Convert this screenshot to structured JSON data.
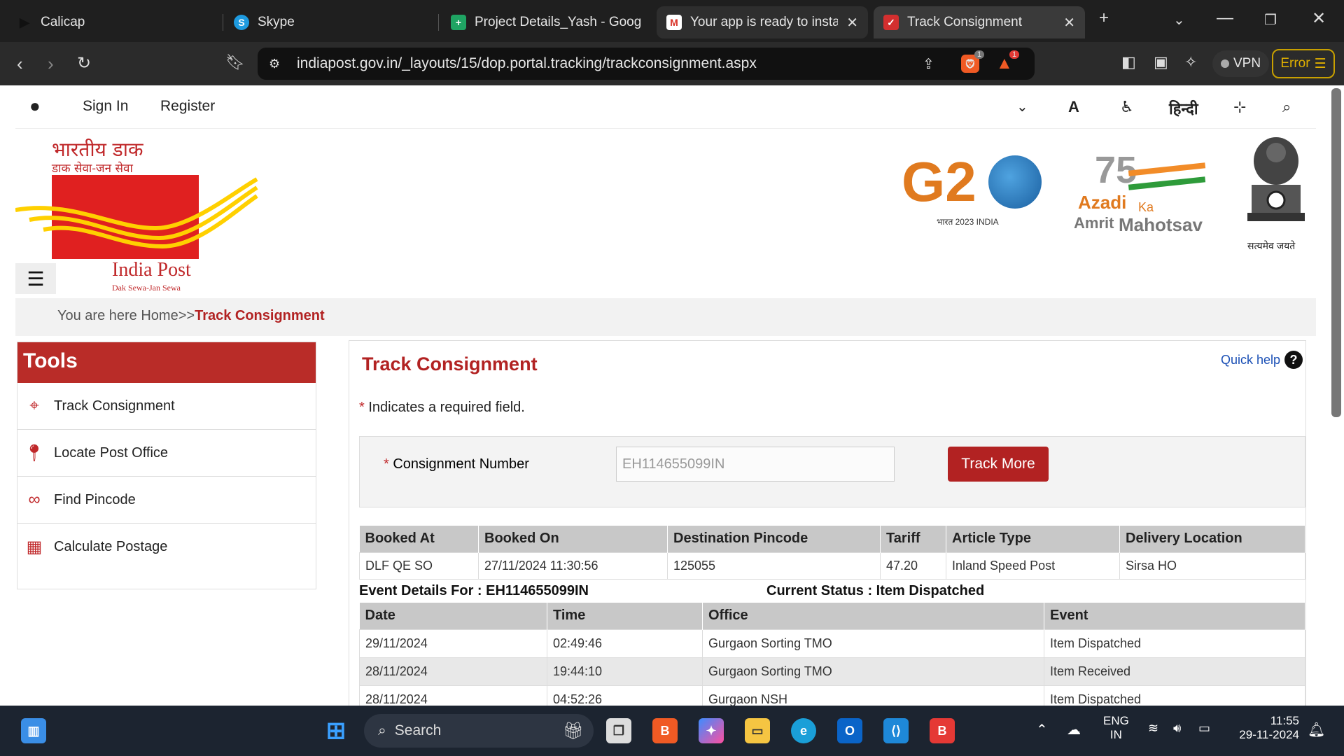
{
  "browser": {
    "tabs": [
      {
        "label": "Calicap",
        "icon": "play-icon"
      },
      {
        "label": "Skype",
        "icon": "skype-icon"
      },
      {
        "label": "Project Details_Yash - Google",
        "icon": "sheets-icon"
      },
      {
        "label": "Your app is ready to insta",
        "icon": "gmail-icon"
      },
      {
        "label": "Track Consignment",
        "icon": "india-post-icon"
      }
    ],
    "url": "indiapost.gov.in/_layouts/15/dop.portal.tracking/trackconsignment.aspx",
    "vpn_label": "VPN",
    "error_label": "Error",
    "badge_counts": [
      "1",
      "1"
    ]
  },
  "site": {
    "sign_in": "Sign In",
    "register": "Register",
    "hindi": "हिन्दी",
    "logo": {
      "hindi_title": "भारतीय डाक",
      "hindi_sub": "डाक सेवा-जन सेवा",
      "title": "India Post",
      "tagline": "Dak Sewa-Jan Sewa"
    },
    "g20_text": "भारत 2023 INDIA",
    "azadi": {
      "line1": "Azadi",
      "ka": "Ka",
      "amrit": "Amrit",
      "mahotsav": "Mahotsav"
    },
    "emblem_motto": "सत्यमेव जयते"
  },
  "breadcrumb": {
    "prefix": "You are here Home>>",
    "current": "Track Consignment"
  },
  "tools": {
    "title": "Tools",
    "items": [
      {
        "label": "Track Consignment",
        "icon": "crosshair-icon"
      },
      {
        "label": "Locate Post Office",
        "icon": "map-pin-icon"
      },
      {
        "label": "Find Pincode",
        "icon": "binoculars-icon"
      },
      {
        "label": "Calculate Postage",
        "icon": "calculator-icon"
      }
    ]
  },
  "main": {
    "title": "Track Consignment",
    "quick_help": "Quick help",
    "required_note": "Indicates a required field.",
    "form": {
      "label": "Consignment Number",
      "value": "EH114655099IN",
      "button": "Track More"
    },
    "booking": {
      "headers": [
        "Booked At",
        "Booked On",
        "Destination Pincode",
        "Tariff",
        "Article Type",
        "Delivery Location"
      ],
      "row": [
        "DLF QE SO",
        "27/11/2024 11:30:56",
        "125055",
        "47.20",
        "Inland Speed Post",
        "Sirsa HO"
      ]
    },
    "event_for_label": "Event Details For : EH114655099IN",
    "current_status": "Current Status : Item Dispatched",
    "events": {
      "headers": [
        "Date",
        "Time",
        "Office",
        "Event"
      ],
      "rows": [
        [
          "29/11/2024",
          "02:49:46",
          "Gurgaon Sorting TMO",
          "Item Dispatched"
        ],
        [
          "28/11/2024",
          "19:44:10",
          "Gurgaon Sorting TMO",
          "Item Received"
        ],
        [
          "28/11/2024",
          "04:52:26",
          "Gurgaon NSH",
          "Item Dispatched"
        ]
      ]
    }
  },
  "taskbar": {
    "search": "Search",
    "lang_top": "ENG",
    "lang_bottom": "IN",
    "time": "11:55",
    "date": "29-11-2024"
  }
}
